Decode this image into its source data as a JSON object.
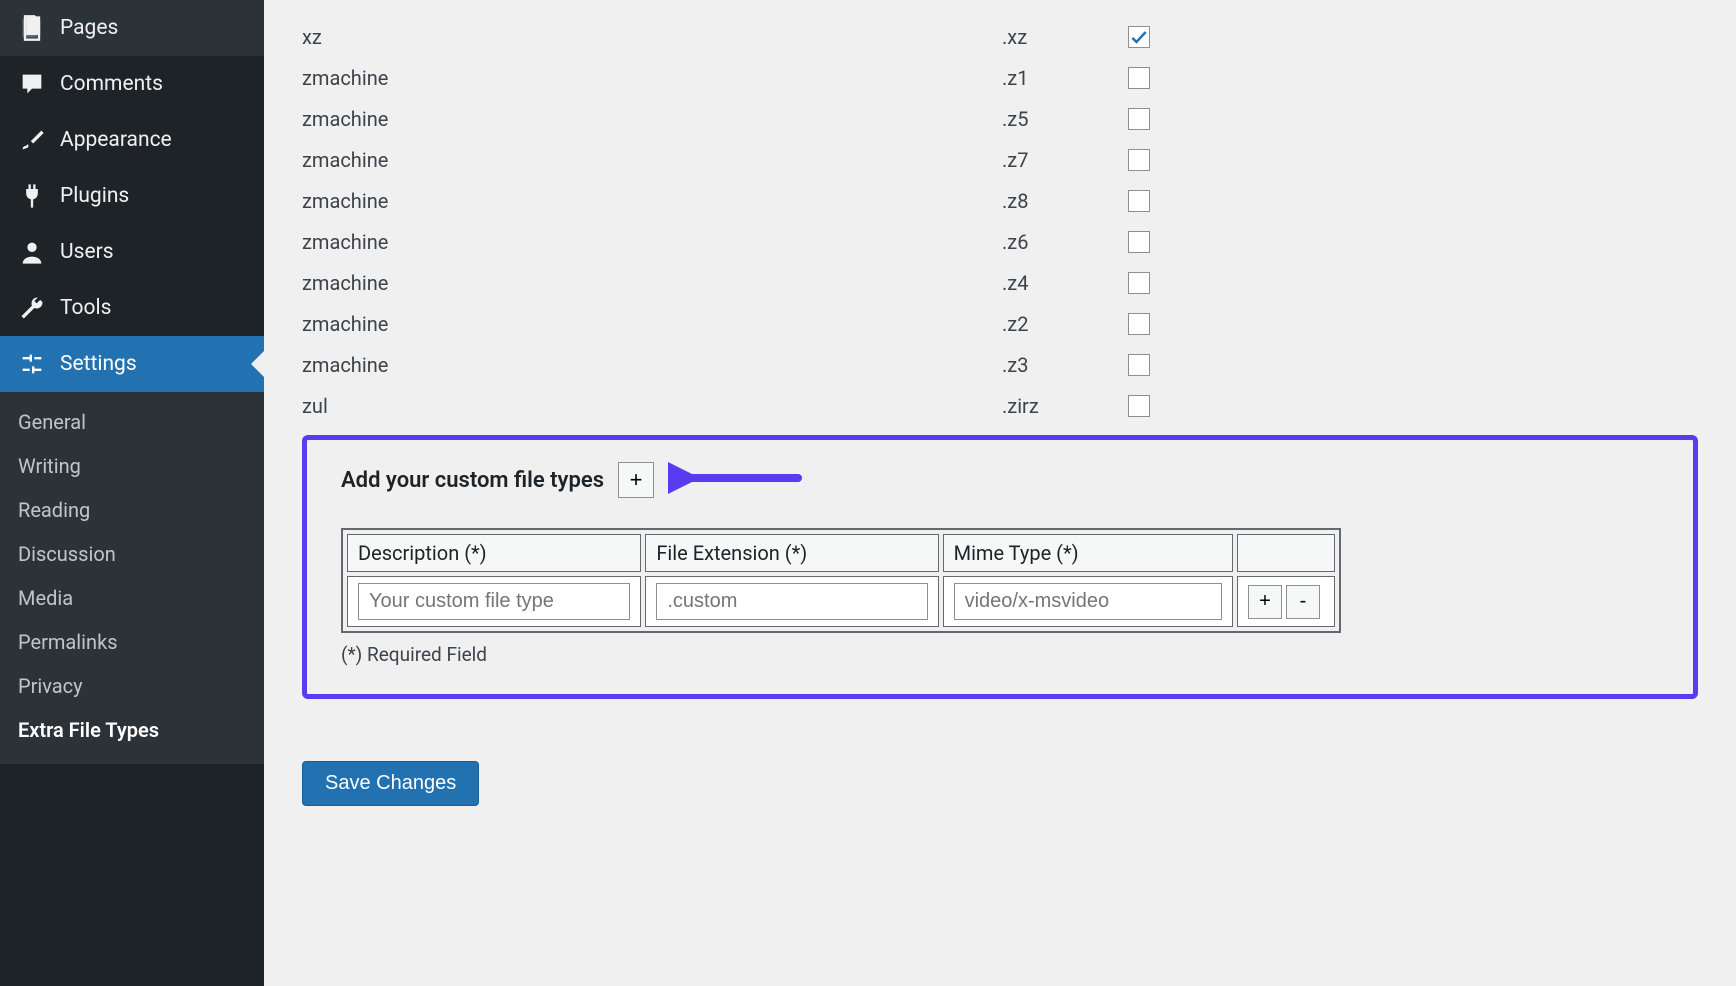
{
  "sidebar": {
    "items": [
      {
        "name": "pages",
        "label": "Pages",
        "icon": "page"
      },
      {
        "name": "comments",
        "label": "Comments",
        "icon": "comment"
      },
      {
        "name": "appearance",
        "label": "Appearance",
        "icon": "brush"
      },
      {
        "name": "plugins",
        "label": "Plugins",
        "icon": "plug"
      },
      {
        "name": "users",
        "label": "Users",
        "icon": "user"
      },
      {
        "name": "tools",
        "label": "Tools",
        "icon": "wrench"
      },
      {
        "name": "settings",
        "label": "Settings",
        "icon": "sliders",
        "active": true
      }
    ],
    "sub": [
      {
        "name": "general",
        "label": "General"
      },
      {
        "name": "writing",
        "label": "Writing"
      },
      {
        "name": "reading",
        "label": "Reading"
      },
      {
        "name": "discussion",
        "label": "Discussion"
      },
      {
        "name": "media",
        "label": "Media"
      },
      {
        "name": "permalinks",
        "label": "Permalinks"
      },
      {
        "name": "privacy",
        "label": "Privacy"
      },
      {
        "name": "extra-file-types",
        "label": "Extra File Types",
        "current": true
      }
    ]
  },
  "fileTypes": [
    {
      "name": "xz",
      "ext": ".xz",
      "checked": true
    },
    {
      "name": "zmachine",
      "ext": ".z1",
      "checked": false
    },
    {
      "name": "zmachine",
      "ext": ".z5",
      "checked": false
    },
    {
      "name": "zmachine",
      "ext": ".z7",
      "checked": false
    },
    {
      "name": "zmachine",
      "ext": ".z8",
      "checked": false
    },
    {
      "name": "zmachine",
      "ext": ".z6",
      "checked": false
    },
    {
      "name": "zmachine",
      "ext": ".z4",
      "checked": false
    },
    {
      "name": "zmachine",
      "ext": ".z2",
      "checked": false
    },
    {
      "name": "zmachine",
      "ext": ".z3",
      "checked": false
    },
    {
      "name": "zul",
      "ext": ".zirz",
      "checked": false
    }
  ],
  "custom": {
    "addLabel": "Add your custom file types",
    "addButton": "+",
    "headers": {
      "desc": "Description (*)",
      "ext": "File Extension (*)",
      "mime": "Mime Type (*)"
    },
    "row": {
      "descPlaceholder": "Your custom file type",
      "extPlaceholder": ".custom",
      "mimePlaceholder": "video/x-msvideo"
    },
    "rowAdd": "+",
    "rowRemove": "-",
    "requiredNote": "(*) Required Field"
  },
  "save": "Save Changes"
}
